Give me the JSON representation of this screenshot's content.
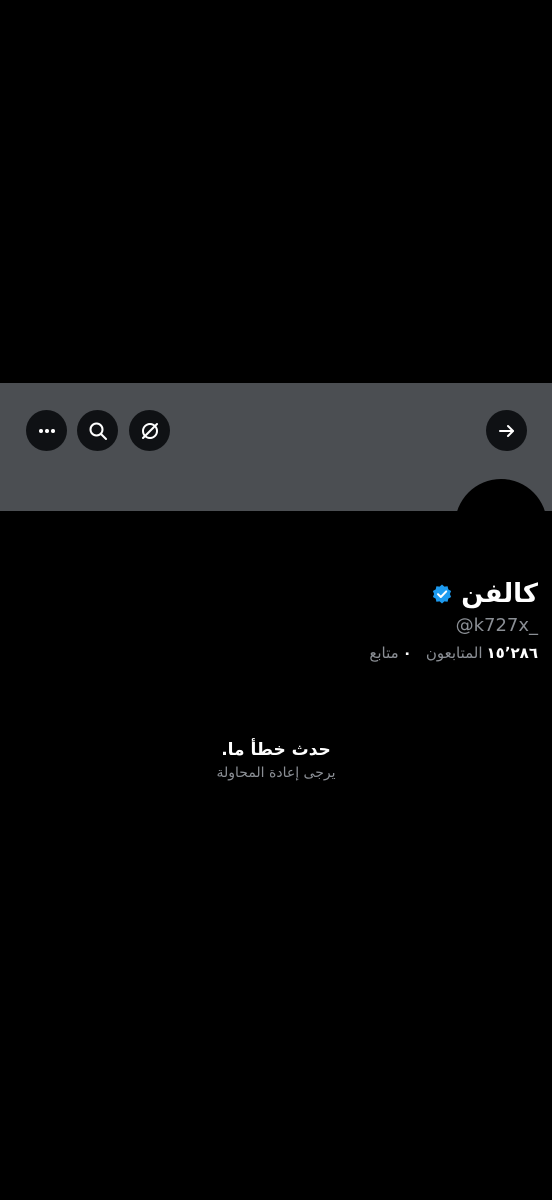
{
  "profile": {
    "display_name": "كالفن",
    "handle": "@k727x_",
    "verified": true,
    "stats": {
      "following_count": "٠",
      "following_label": "متابع",
      "followers_count": "١٥٬٢٨٦",
      "followers_label": "المتابعون"
    }
  },
  "header": {
    "icons": [
      "more-icon",
      "search-icon",
      "translate-icon",
      "back-arrow-icon"
    ]
  },
  "error": {
    "title": "حدث خطأ ما.",
    "subtitle": "يرجى إعادة المحاولة"
  },
  "colors": {
    "background": "#000000",
    "banner": "#4b4e52",
    "button_bg": "#0f1114",
    "verified_blue": "#1d9bf0",
    "secondary_text": "#8b8f95"
  }
}
